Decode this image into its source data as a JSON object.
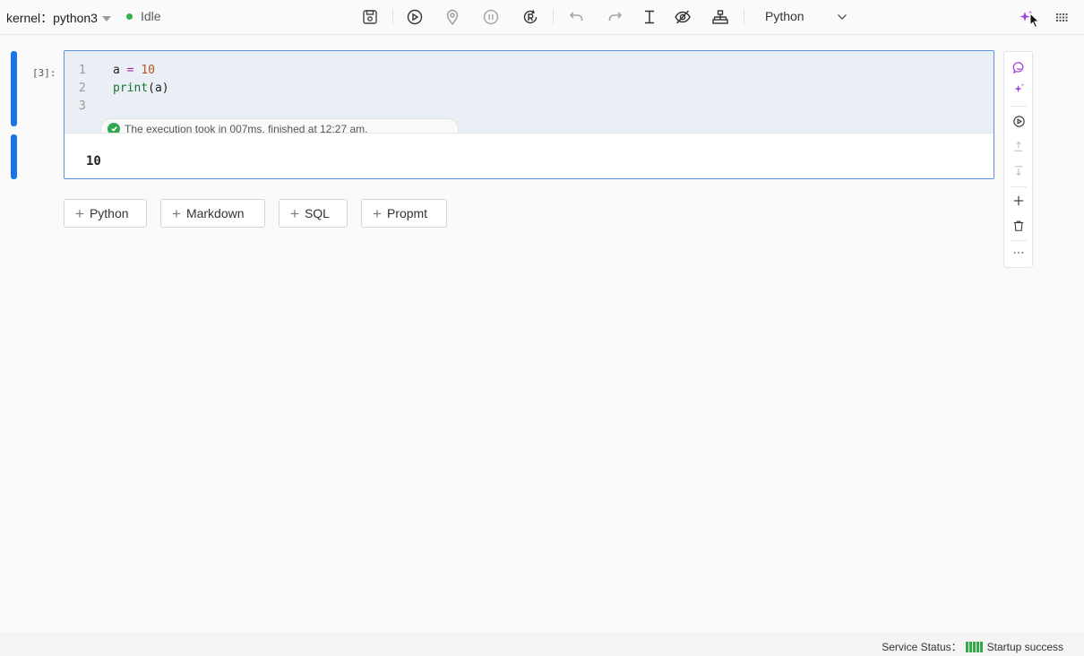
{
  "toolbar": {
    "kernel_label": "kernel：",
    "kernel_name": "python3",
    "kernel_status": "Idle",
    "language": "Python"
  },
  "cell": {
    "execution_count": "[3]:",
    "lines": [
      {
        "number": "1",
        "tokens": [
          "a ",
          "=",
          " ",
          "10"
        ]
      },
      {
        "number": "2",
        "tokens": [
          "print",
          "(a)"
        ]
      },
      {
        "number": "3",
        "tokens": []
      }
    ],
    "exec_info": "The execution took in 007ms, finished at 12:27 am.",
    "output": "10"
  },
  "add_buttons": [
    "Python",
    "Markdown",
    "SQL",
    "Propmt"
  ],
  "status_bar": {
    "label": "Service Status：",
    "value": "Startup success"
  },
  "colors": {
    "accent": "#1a73e8",
    "status_green": "#35b34a",
    "ai_purple": "#9b3fd6"
  },
  "icons": {
    "toolbar": [
      "save-icon",
      "run-icon",
      "location-icon",
      "pause-icon",
      "restart-icon",
      "undo-icon",
      "redo-icon",
      "text-cursor-icon",
      "eye-off-icon",
      "sitemap-icon",
      "chevron-down-icon",
      "sparkle-icon",
      "grid-menu-icon"
    ],
    "side": [
      "chat-icon",
      "sparkle-icon",
      "run-icon",
      "move-up-icon",
      "move-down-icon",
      "add-icon",
      "delete-icon",
      "more-icon"
    ]
  }
}
